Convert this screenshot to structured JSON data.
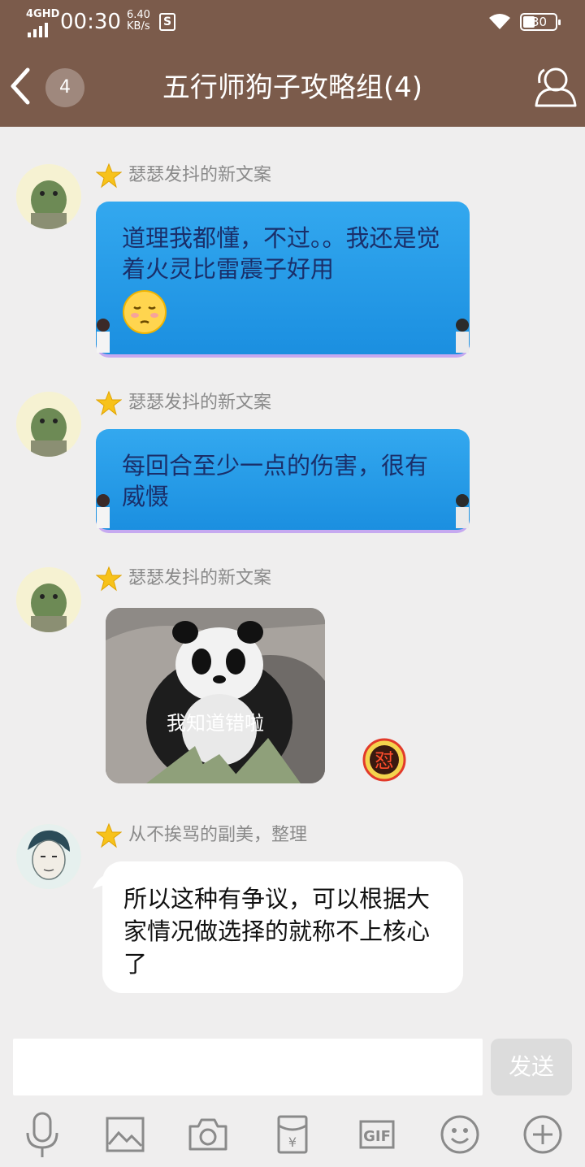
{
  "status_bar": {
    "network": "4GHD",
    "time": "00:30",
    "speed_value": "6.40",
    "speed_unit": "KB/s",
    "s_icon_letter": "S",
    "battery": "30"
  },
  "header": {
    "unread_count": "4",
    "title": "五行师狗子攻略组(4)"
  },
  "messages": [
    {
      "sender": "瑟瑟发抖的新文案",
      "text": "道理我都懂，不过。。我还是觉着火灵比雷震子好用",
      "type": "bubble"
    },
    {
      "sender": "瑟瑟发抖的新文案",
      "text": "每回合至少一点的伤害，很有威慑",
      "type": "bubble"
    },
    {
      "sender": "瑟瑟发抖的新文案",
      "sticker_caption": "我知道错啦",
      "reaction": "怼",
      "type": "sticker"
    },
    {
      "sender": "从不挨骂的副美，整理",
      "text": "所以这种有争议，可以根据大家情况做选择的就称不上核心了",
      "type": "bubble"
    }
  ],
  "composer": {
    "value": "",
    "send_label": "发送"
  },
  "toolbar": {
    "items": [
      "microphone-icon",
      "image-icon",
      "camera-icon",
      "red-packet-icon",
      "gif-icon",
      "emoji-icon",
      "plus-icon"
    ],
    "gif_label": "GIF",
    "red_packet_symbol": "¥"
  },
  "colors": {
    "header_bg": "#7b5b4b",
    "page_bg": "#efeeee",
    "bubble_blue": "#2a9ee8",
    "bubble_text": "#1a2f6a",
    "send_disabled": "#dcdcdc"
  }
}
